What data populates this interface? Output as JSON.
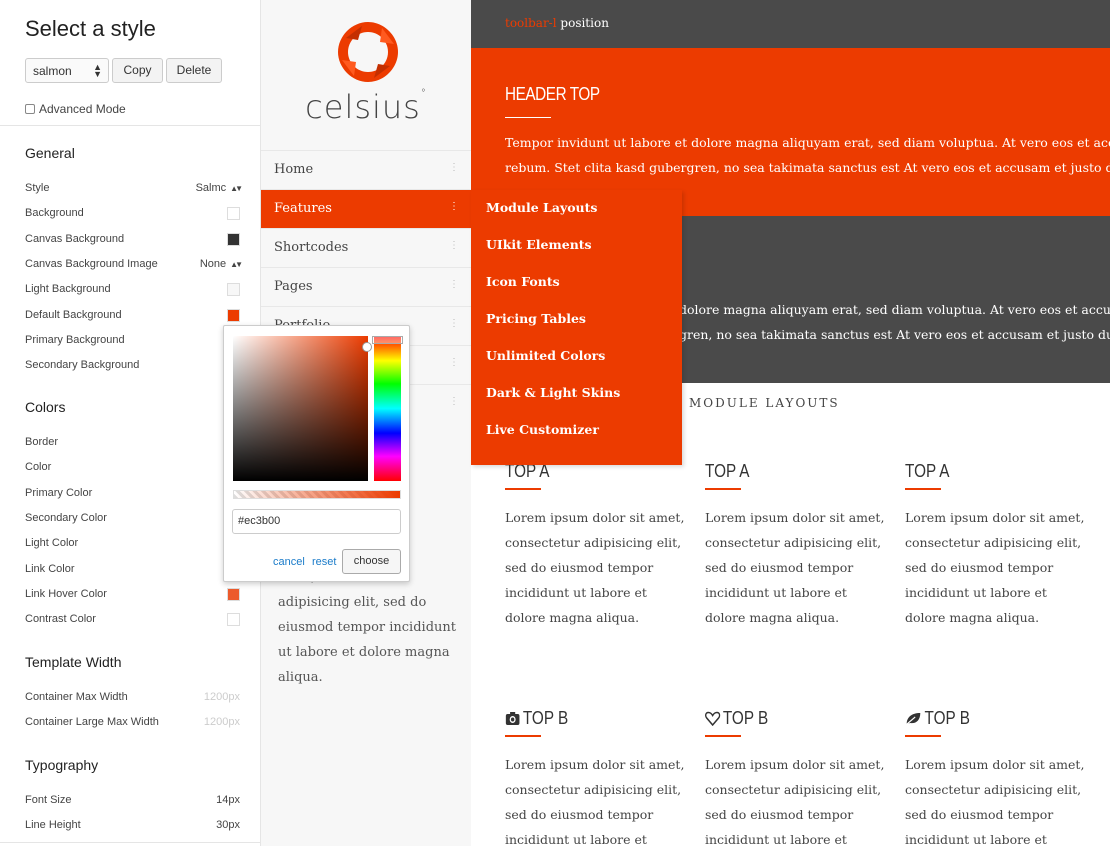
{
  "customizer": {
    "title": "Select a style",
    "style_select": "salmon",
    "copy_label": "Copy",
    "delete_label": "Delete",
    "advanced_label": "Advanced Mode",
    "sections": {
      "general": "General",
      "colors": "Colors",
      "template_width": "Template Width",
      "typography": "Typography"
    },
    "general": [
      {
        "label": "Style",
        "value": "Salmc"
      },
      {
        "label": "Background",
        "swatch": "#ffffff"
      },
      {
        "label": "Canvas Background",
        "swatch": "#333333"
      },
      {
        "label": "Canvas Background Image",
        "value": "None"
      },
      {
        "label": "Light Background",
        "swatch": "#f7f7f7"
      },
      {
        "label": "Default Background",
        "swatch": "#ec3b00"
      },
      {
        "label": "Primary Background"
      },
      {
        "label": "Secondary Background"
      }
    ],
    "colors": [
      {
        "label": "Border"
      },
      {
        "label": "Color"
      },
      {
        "label": "Primary Color"
      },
      {
        "label": "Secondary Color"
      },
      {
        "label": "Light Color"
      },
      {
        "label": "Link Color"
      },
      {
        "label": "Link Hover Color",
        "swatch": "#ec5a2c"
      },
      {
        "label": "Contrast Color",
        "swatch": "#ffffff"
      }
    ],
    "template_width": [
      {
        "label": "Container Max Width",
        "value": "1200px"
      },
      {
        "label": "Container Large Max Width",
        "value": "1200px"
      }
    ],
    "typography": [
      {
        "label": "Font Size",
        "value": "14px"
      },
      {
        "label": "Line Height",
        "value": "30px"
      }
    ]
  },
  "picker": {
    "hex": "#ec3b00",
    "cancel": "cancel",
    "reset": "reset",
    "choose": "choose"
  },
  "site": {
    "logo_text": "celsius",
    "logo_mark": "°",
    "nav": [
      "Home",
      "Features",
      "Shortcodes",
      "Pages",
      "Portfolio",
      "",
      ""
    ],
    "nav_active_index": 1,
    "dropdown": [
      "Module Layouts",
      "UIkit Elements",
      "Icon Fonts",
      "Pricing Tables",
      "Unlimited Colors",
      "Dark & Light Skins",
      "Live Customizer"
    ],
    "sidebar_text": "amet, consectetur adipisicing elit, sed do eiusmod tempor incididunt ut labore et dolore magna aliqua."
  },
  "main": {
    "toolbar_a": "toolbar-l",
    "toolbar_b": "position",
    "header_top_title": "HEADER TOP",
    "header_top_line1": "Tempor invidunt ut labore et dolore magna aliquyam erat, sed diam voluptua. At vero eos et accusam et",
    "header_top_line2": "rebum. Stet clita kasd gubergren, no sea takimata sanctus est At vero eos et accusam et justo duo dolores",
    "dark_line1": "dolore magna aliquyam erat, sed diam voluptua. At vero eos et accusam et",
    "dark_line2": "gren, no sea takimata sanctus est At vero eos et accusam et justo duo dolores",
    "module_heading": "MODULE LAYOUTS",
    "cards_a": [
      {
        "title": "TOP A",
        "text": "Lorem ipsum dolor sit amet, consectetur adipisicing elit, sed do eiusmod tempor incididunt ut labore et dolore magna aliqua."
      },
      {
        "title": "TOP A",
        "text": "Lorem ipsum dolor sit amet, consectetur adipisicing elit, sed do eiusmod tempor incididunt ut labore et dolore magna aliqua."
      },
      {
        "title": "TOP A",
        "text": "Lorem ipsum dolor sit amet, consectetur adipisicing elit, sed do eiusmod tempor incididunt ut labore et dolore magna aliqua."
      }
    ],
    "cards_b": [
      {
        "title": "TOP B",
        "icon": "camera-icon",
        "text": "Lorem ipsum dolor sit amet, consectetur adipisicing elit, sed do eiusmod tempor incididunt ut labore et dolore"
      },
      {
        "title": "TOP B",
        "icon": "heart-icon",
        "text": "Lorem ipsum dolor sit amet, consectetur adipisicing elit, sed do eiusmod tempor incididunt ut labore et dolore"
      },
      {
        "title": "TOP B",
        "icon": "leaf-icon",
        "text": "Lorem ipsum dolor sit amet, consectetur adipisicing elit, sed do eiusmod tempor incididunt ut labore et dolore"
      }
    ]
  }
}
